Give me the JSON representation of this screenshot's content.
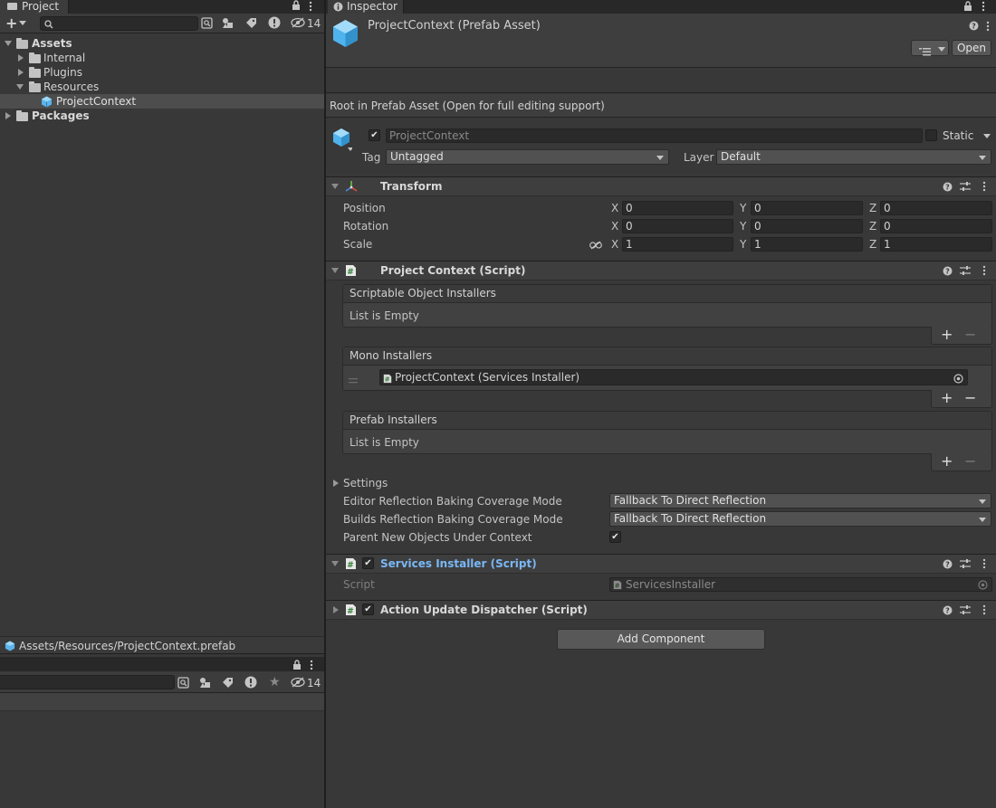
{
  "project_panel": {
    "tab_label": "Project",
    "hidden_count": "14",
    "tree": [
      {
        "label": "Assets",
        "bold": true
      },
      {
        "label": "Internal"
      },
      {
        "label": "Plugins"
      },
      {
        "label": "Resources"
      },
      {
        "label": "ProjectContext"
      },
      {
        "label": "Packages",
        "bold": true
      }
    ],
    "path_bar": "Assets/Resources/ProjectContext.prefab"
  },
  "lower_panel": {
    "hidden_count": "14"
  },
  "inspector": {
    "tab_label": "Inspector",
    "asset_title": "ProjectContext (Prefab Asset)",
    "open_button": "Open",
    "root_notice": "Root in Prefab Asset (Open for full editing support)",
    "object_name": "ProjectContext",
    "static_label": "Static",
    "tag_label": "Tag",
    "tag_value": "Untagged",
    "layer_label": "Layer",
    "layer_value": "Default",
    "transform": {
      "title": "Transform",
      "position_label": "Position",
      "rotation_label": "Rotation",
      "scale_label": "Scale",
      "x": "X",
      "y": "Y",
      "z": "Z",
      "position": [
        "0",
        "0",
        "0"
      ],
      "rotation": [
        "0",
        "0",
        "0"
      ],
      "scale": [
        "1",
        "1",
        "1"
      ]
    },
    "project_context": {
      "title": "Project Context (Script)",
      "so_installers_label": "Scriptable Object Installers",
      "so_empty": "List is Empty",
      "mono_installers_label": "Mono Installers",
      "mono_item": "ProjectContext (Services Installer)",
      "prefab_installers_label": "Prefab Installers",
      "prefab_empty": "List is Empty",
      "settings_label": "Settings",
      "editor_baking_label": "Editor Reflection Baking Coverage Mode",
      "editor_baking_value": "Fallback To Direct Reflection",
      "builds_baking_label": "Builds Reflection Baking Coverage Mode",
      "builds_baking_value": "Fallback To Direct Reflection",
      "parent_label": "Parent New Objects Under Context"
    },
    "services_installer": {
      "title": "Services Installer (Script)",
      "script_label": "Script",
      "script_value": "ServicesInstaller"
    },
    "action_dispatcher": {
      "title": "Action Update Dispatcher (Script)"
    },
    "add_component": "Add Component"
  },
  "colors": {
    "accent_blue": "#7ab7f5",
    "selection": "#4d4d4d",
    "background": "#383838"
  }
}
